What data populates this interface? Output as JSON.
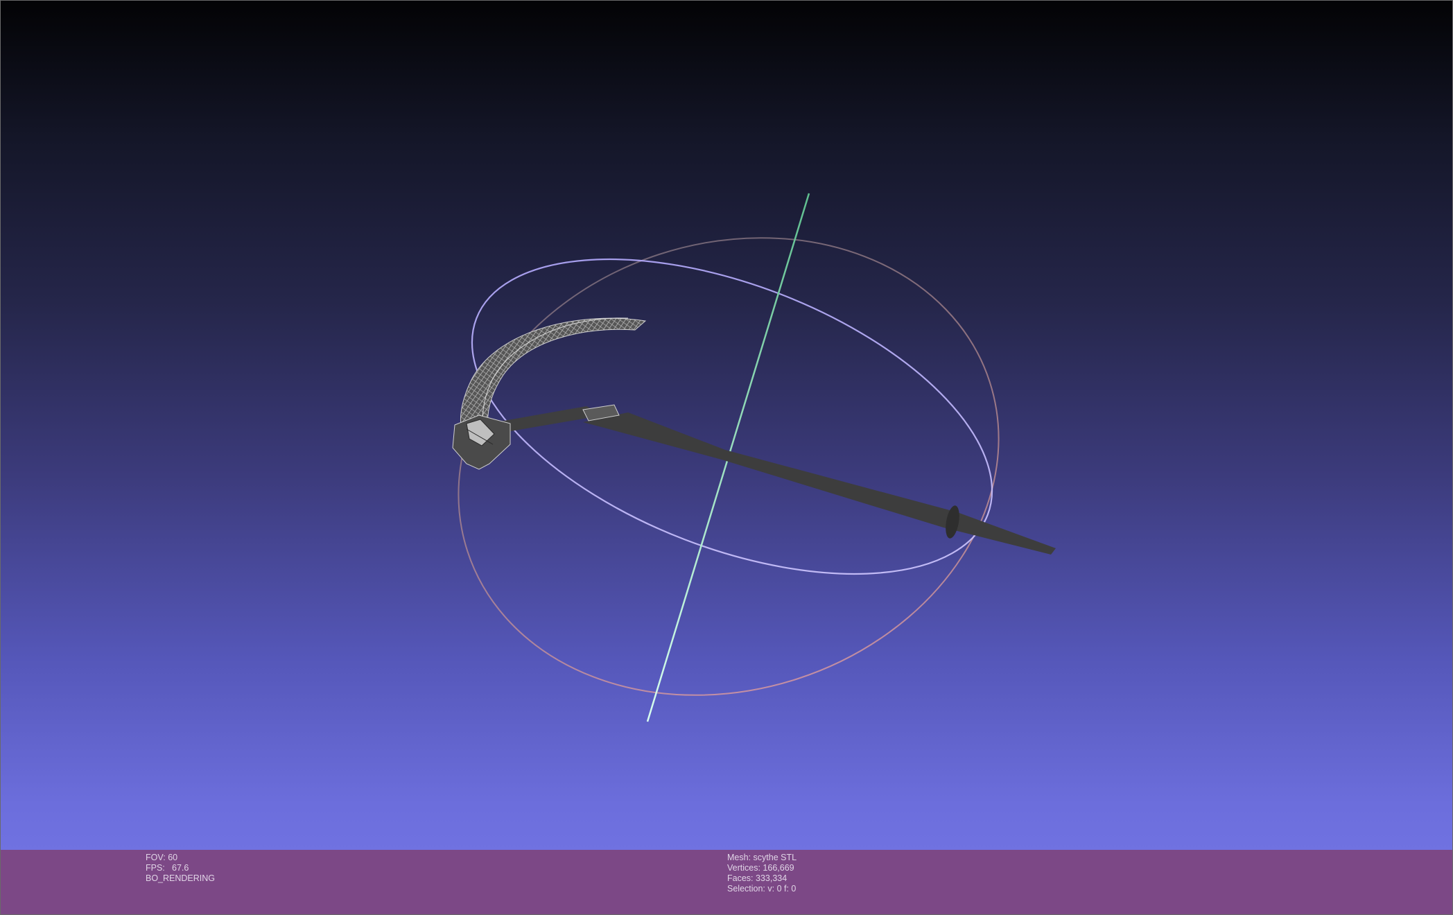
{
  "viewport": {
    "background_top": "#030305",
    "background_bottom": "#7577e8",
    "mesh_color": "#3e3e3e",
    "trackball_colors": [
      "#c0b6ff",
      "#9a8a8a",
      "#6fe0b0",
      "#e89a9a"
    ]
  },
  "info_left": {
    "fov_label": "FOV:",
    "fov_value": "60",
    "fps_label": "FPS:",
    "fps_value": "67.6",
    "render_mode": "BO_RENDERING"
  },
  "info_right": {
    "mesh_label": "Mesh:",
    "mesh_value": "scythe STL",
    "vertices_label": "Vertices:",
    "vertices_value": "166,669",
    "faces_label": "Faces:",
    "faces_value": "333,334",
    "selection_label": "Selection:",
    "selection_value": "v: 0 f: 0"
  },
  "colors": {
    "info_bar_bg": "#7c4886",
    "info_text": "#e0d4e6"
  }
}
